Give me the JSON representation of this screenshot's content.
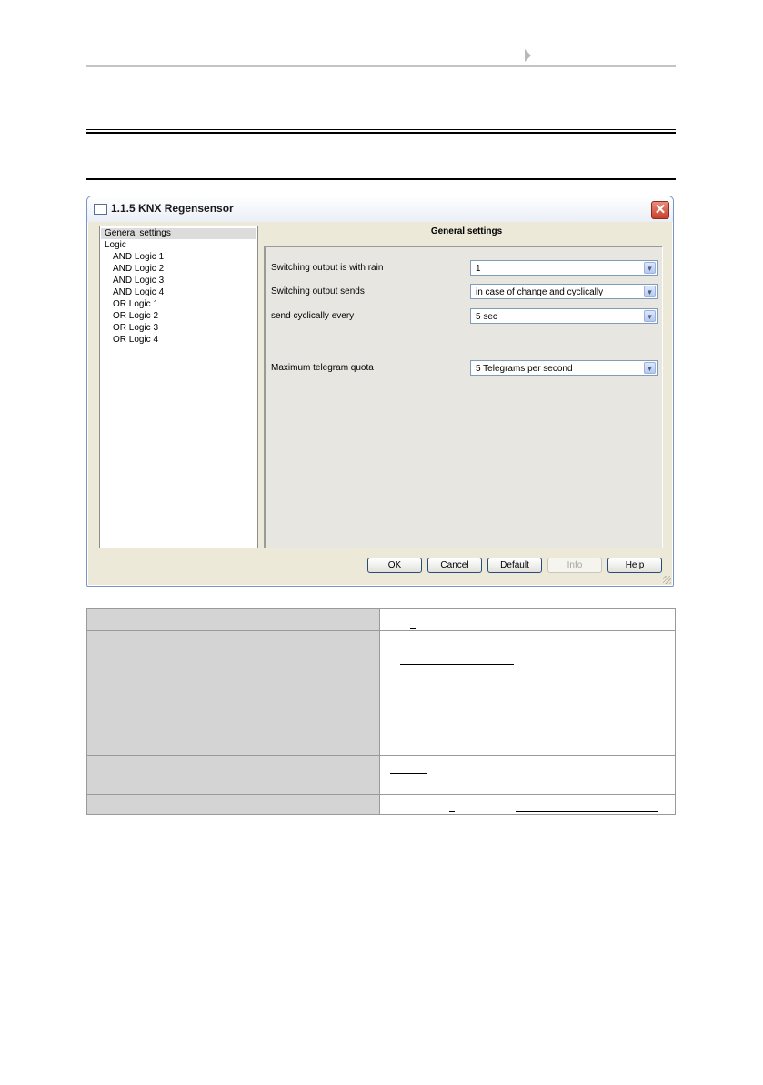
{
  "dialog": {
    "title": "1.1.5 KNX Regensensor",
    "close_glyph": "✕",
    "tree": {
      "items": [
        {
          "label": "General settings",
          "indent": 0,
          "selected": true
        },
        {
          "label": "Logic",
          "indent": 0,
          "selected": false
        },
        {
          "label": "AND Logic 1",
          "indent": 1,
          "selected": false
        },
        {
          "label": "AND Logic 2",
          "indent": 1,
          "selected": false
        },
        {
          "label": "AND Logic 3",
          "indent": 1,
          "selected": false
        },
        {
          "label": "AND Logic 4",
          "indent": 1,
          "selected": false
        },
        {
          "label": "OR Logic 1",
          "indent": 1,
          "selected": false
        },
        {
          "label": "OR Logic 2",
          "indent": 1,
          "selected": false
        },
        {
          "label": "OR Logic 3",
          "indent": 1,
          "selected": false
        },
        {
          "label": "OR Logic 4",
          "indent": 1,
          "selected": false
        }
      ]
    },
    "panel_title": "General settings",
    "params": [
      {
        "label": "Switching output is with rain",
        "value": "1"
      },
      {
        "label": "Switching output sends",
        "value": "in case of change and cyclically"
      },
      {
        "label": "send cyclically every",
        "value": "5 sec"
      },
      {
        "label": "Maximum telegram quota",
        "value": "5 Telegrams per second"
      }
    ],
    "buttons": {
      "ok": "OK",
      "cancel": "Cancel",
      "default": "Default",
      "info": "Info",
      "help": "Help"
    },
    "dropdown_glyph": "▼"
  }
}
